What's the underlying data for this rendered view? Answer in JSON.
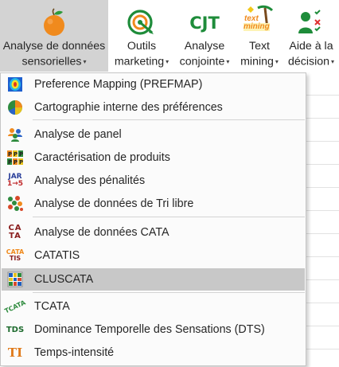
{
  "ribbon": {
    "sensorielles": {
      "line1": "Analyse de données",
      "line2": "sensorielles"
    },
    "marketing": {
      "line1": "Outils",
      "line2": "marketing"
    },
    "conjointe": {
      "line1": "Analyse",
      "line2": "conjointe",
      "icon_text": "CJT"
    },
    "text_mining": {
      "line1": "Text",
      "line2": "mining",
      "icon_text_top": "text",
      "icon_text_bottom": "mining"
    },
    "aide": {
      "line1": "Aide à la",
      "line2": "décision"
    },
    "caret": "▾"
  },
  "menu": {
    "items": [
      {
        "label": "Preference Mapping (PREFMAP)",
        "icon": "prefmap-icon"
      },
      {
        "label": "Cartographie interne des préférences",
        "icon": "pie-chart-icon"
      },
      {
        "label": "Analyse de panel",
        "icon": "panel-people-icon"
      },
      {
        "label": "Caractérisation de produits",
        "icon": "product-p-icon"
      },
      {
        "label": "Analyse des pénalités",
        "icon": "jar-penalty-icon",
        "icon_top": "JAR",
        "icon_bottom": "1→5"
      },
      {
        "label": "Analyse de données de Tri libre",
        "icon": "free-sorting-icon"
      },
      {
        "label": "Analyse de données CATA",
        "icon": "cata-icon",
        "icon_top": "CA",
        "icon_bottom": "TA"
      },
      {
        "label": "CATATIS",
        "icon": "catatis-icon",
        "icon_top": "CATA",
        "icon_bottom": "TIS"
      },
      {
        "label": "CLUSCATA",
        "icon": "cluscata-icon",
        "highlighted": true
      },
      {
        "label": "TCATA",
        "icon": "tcata-icon",
        "icon_text": "TCATA"
      },
      {
        "label": "Dominance Temporelle des Sensations (DTS)",
        "icon": "tds-icon",
        "icon_text": "TDS"
      },
      {
        "label": "Temps-intensité",
        "icon": "ti-icon",
        "icon_text": "TI"
      }
    ]
  },
  "colors": {
    "highlight": "#c8c8c8",
    "ribbon_active": "#d3d3d3",
    "orange": "#f08a1d",
    "green": "#1e8c3a",
    "cluscata_blue": "#1f5fbf"
  }
}
